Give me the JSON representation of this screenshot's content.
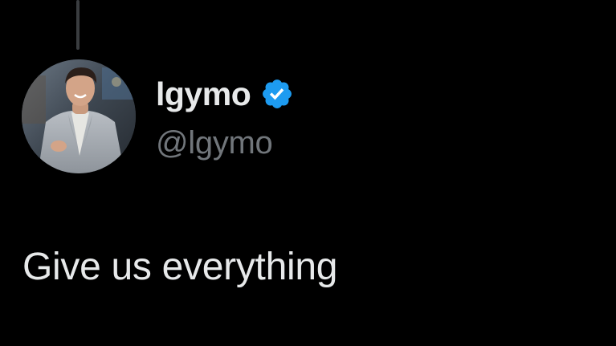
{
  "author": {
    "display_name": "lgymo",
    "handle": "@lgymo",
    "verified": true,
    "verified_icon": "verified-badge-icon",
    "avatar": "profile-photo"
  },
  "tweet": {
    "text": "Give us everything"
  },
  "colors": {
    "background": "#000000",
    "primary_text": "#e7e9ea",
    "secondary_text": "#71767b",
    "verified_blue": "#1d9bf0",
    "thread_line": "#3a3d40"
  }
}
